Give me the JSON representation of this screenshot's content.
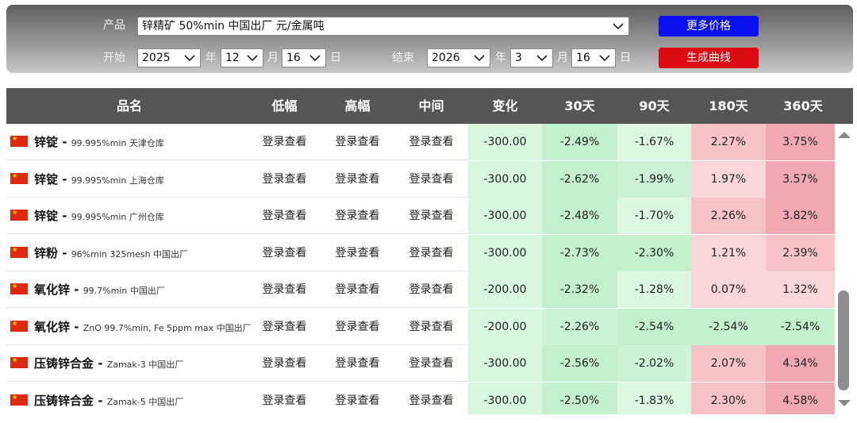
{
  "controls": {
    "product_label": "产品",
    "product_value": "锌精矿 50%min 中国出厂 元/金属吨",
    "start_label": "开始",
    "start_year": "2025",
    "start_month": "12",
    "start_day": "16",
    "end_label": "结束",
    "end_year": "2026",
    "end_month": "3",
    "end_day": "16",
    "year_unit": "年",
    "month_unit": "月",
    "day_unit": "日",
    "more_prices_label": "更多价格",
    "generate_curve_label": "生成曲线"
  },
  "table": {
    "headers": [
      "品名",
      "低幅",
      "高幅",
      "中间",
      "变化",
      "30天",
      "90天",
      "180天",
      "360天"
    ],
    "rows": [
      {
        "name": "锌锭",
        "spec": "99.995%min 天津仓库",
        "low": "登录查看",
        "high": "登录查看",
        "mid": "登录查看",
        "change": "-300.00",
        "d30": "-2.49%",
        "d90": "-1.67%",
        "d180": "2.27%",
        "d360": "3.75%"
      },
      {
        "name": "锌锭",
        "spec": "99.995%min 上海仓库",
        "low": "登录查看",
        "high": "登录查看",
        "mid": "登录查看",
        "change": "-300.00",
        "d30": "-2.62%",
        "d90": "-1.99%",
        "d180": "1.97%",
        "d360": "3.57%"
      },
      {
        "name": "锌锭",
        "spec": "99.995%min 广州仓库",
        "low": "登录查看",
        "high": "登录查看",
        "mid": "登录查看",
        "change": "-300.00",
        "d30": "-2.48%",
        "d90": "-1.70%",
        "d180": "2.26%",
        "d360": "3.82%"
      },
      {
        "name": "锌粉",
        "spec": "96%min 325mesh 中国出厂",
        "low": "登录查看",
        "high": "登录查看",
        "mid": "登录查看",
        "change": "-300.00",
        "d30": "-2.73%",
        "d90": "-2.30%",
        "d180": "1.21%",
        "d360": "2.39%"
      },
      {
        "name": "氧化锌",
        "spec": "99.7%min 中国出厂",
        "low": "登录查看",
        "high": "登录查看",
        "mid": "登录查看",
        "change": "-200.00",
        "d30": "-2.32%",
        "d90": "-1.28%",
        "d180": "0.07%",
        "d360": "1.32%"
      },
      {
        "name": "氧化锌",
        "spec": "ZnO 99.7%min, Fe 5ppm max 中国出厂",
        "low": "登录查看",
        "high": "登录查看",
        "mid": "登录查看",
        "change": "-200.00",
        "d30": "-2.26%",
        "d90": "-2.54%",
        "d180": "-2.54%",
        "d360": "-2.54%"
      },
      {
        "name": "压铸锌合金",
        "spec": "Zamak-3 中国出厂",
        "low": "登录查看",
        "high": "登录查看",
        "mid": "登录查看",
        "change": "-300.00",
        "d30": "-2.56%",
        "d90": "-2.02%",
        "d180": "2.07%",
        "d360": "4.34%"
      },
      {
        "name": "压铸锌合金",
        "spec": "Zamak-5 中国出厂",
        "low": "登录查看",
        "high": "登录查看",
        "mid": "登录查看",
        "change": "-300.00",
        "d30": "-2.50%",
        "d90": "-1.83%",
        "d180": "2.30%",
        "d360": "4.58%"
      }
    ]
  },
  "colors": {
    "header_bg": "#555555",
    "change_bg": "#d9f7df",
    "neg_strong": "#c3f0cd",
    "neg_mid": "#cdf3d6",
    "neg_light": "#dcf8e1",
    "pos_light": "#fbd6d8",
    "pos_mid": "#f7c3c7",
    "pos_strong": "#f0a9b0",
    "more_button": "#0a10f0",
    "curve_button": "#dd0a14"
  },
  "icons": {
    "flag": "china-flag-icon",
    "dropdown": "chevron-down-icon",
    "scroll_up": "scroll-up-arrow-icon",
    "scroll_down": "scroll-down-arrow-icon"
  }
}
